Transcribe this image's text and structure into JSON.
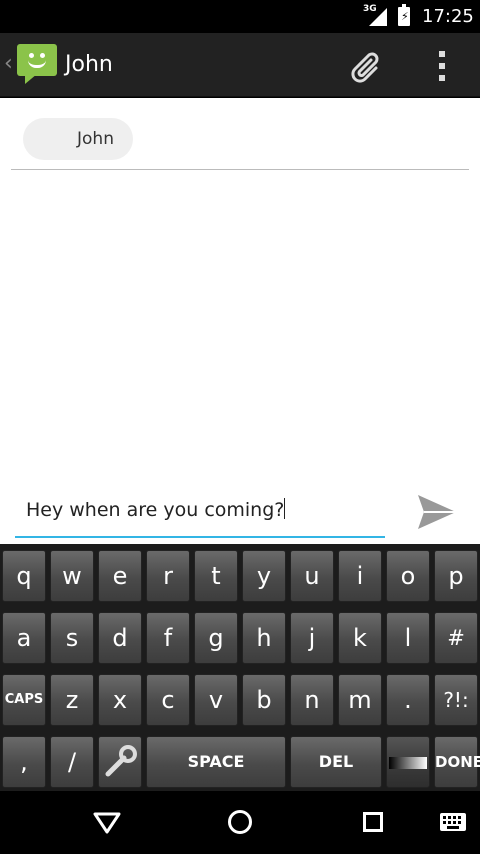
{
  "status_bar": {
    "network": "3G",
    "time": "17:25"
  },
  "action_bar": {
    "title": "John"
  },
  "recipient": {
    "name": "John"
  },
  "compose": {
    "message": "Hey when are you coming?"
  },
  "keyboard": {
    "row1": [
      "q",
      "w",
      "e",
      "r",
      "t",
      "y",
      "u",
      "i",
      "o",
      "p"
    ],
    "row2": [
      "a",
      "s",
      "d",
      "f",
      "g",
      "h",
      "j",
      "k",
      "l",
      "# @"
    ],
    "row3": [
      "CAPS",
      "z",
      "x",
      "c",
      "v",
      "b",
      "n",
      "m",
      ".",
      "?!:"
    ],
    "row4": {
      "comma": ",",
      "slash": "/",
      "space": "SPACE",
      "del": "DEL",
      "done": "DONE"
    }
  },
  "colors": {
    "accent": "#33b5e5",
    "app_icon": "#8bc34a"
  }
}
